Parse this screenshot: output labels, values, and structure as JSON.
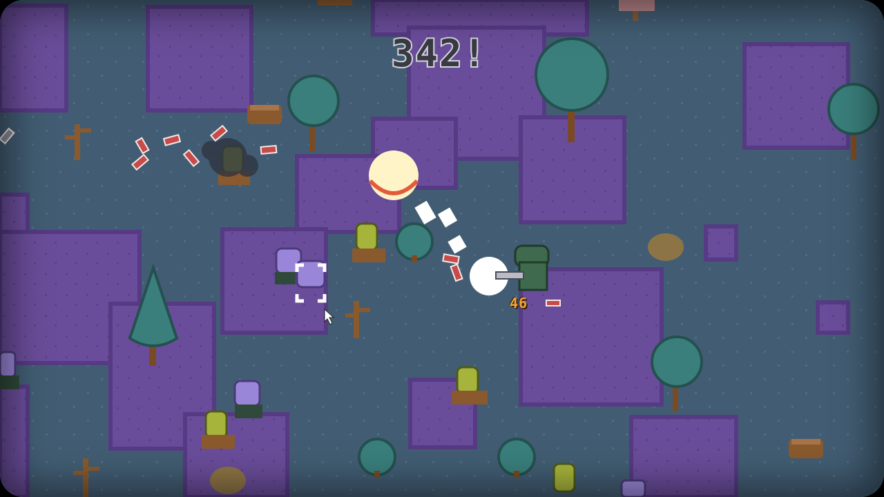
{
  "hud": {
    "score_text": "342!",
    "ammo_count": "46"
  },
  "icons": {
    "ammo": "shotgun-shell-icon",
    "crosshair": "crosshair-icon",
    "cursor": "mouse-pointer-icon"
  },
  "palette": {
    "ground": "#425d73",
    "purple_grass": "#6a4d9a",
    "tree_canopy": "#3a7f7c",
    "trunk": "#7a4a22",
    "zombie_green": "#a7b43c",
    "zombie_purple": "#9a86d8",
    "player": "#3f6a4e",
    "score_fill": "#3a3a44",
    "score_outline": "#d6d6dc",
    "ammo_text": "#f3a63a"
  }
}
